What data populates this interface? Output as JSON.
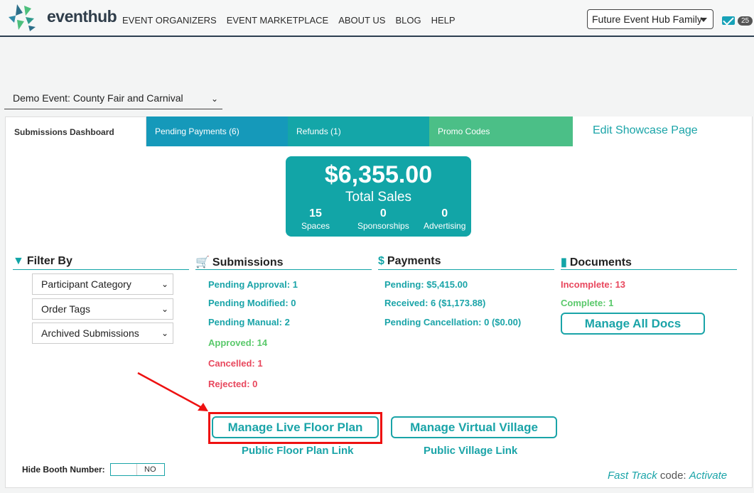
{
  "header": {
    "logo_text": "eventhub",
    "nav": [
      "EVENT ORGANIZERS",
      "EVENT MARKETPLACE",
      "ABOUT US",
      "BLOG",
      "HELP"
    ],
    "family_select": "Future Event Hub Family",
    "mail_badge": "25"
  },
  "event_select": "Demo Event: County Fair and Carnival",
  "tabs": {
    "active": "Submissions Dashboard",
    "pending_payments": "Pending Payments (6)",
    "refunds": "Refunds (1)",
    "promo_codes": "Promo Codes",
    "showcase": "Edit Showcase Page"
  },
  "sales": {
    "amount": "$6,355.00",
    "label": "Total Sales",
    "spaces_n": "15",
    "spaces_l": "Spaces",
    "sponsorships_n": "0",
    "sponsorships_l": "Sponsorships",
    "advertising_n": "0",
    "advertising_l": "Advertising"
  },
  "filter": {
    "heading": "Filter By",
    "options": [
      "Participant Category",
      "Order Tags",
      "Archived Submissions"
    ]
  },
  "submissions": {
    "heading": "Submissions",
    "pending_approval": "Pending Approval: 1",
    "pending_modified": "Pending Modified: 0",
    "pending_manual": "Pending Manual: 2",
    "approved": "Approved: 14",
    "cancelled": "Cancelled: 1",
    "rejected": "Rejected: 0"
  },
  "payments": {
    "heading": "Payments",
    "pending": "Pending: $5,415.00",
    "received": "Received: 6 ($1,173.88)",
    "pending_cancel": "Pending Cancellation: 0 ($0.00)"
  },
  "documents": {
    "heading": "Documents",
    "incomplete": "Incomplete: 13",
    "complete": "Complete: 1",
    "manage": "Manage All Docs"
  },
  "floor": {
    "manage_floor": "Manage Live Floor Plan",
    "public_floor": "Public Floor Plan Link",
    "manage_village": "Manage Virtual Village",
    "public_village": "Public Village Link"
  },
  "booth": {
    "label": "Hide Booth Number:",
    "toggle": "NO"
  },
  "fasttrack": {
    "a": "Fast Track",
    "b": " code: ",
    "c": "Activate"
  },
  "colors": {
    "teal": "#12a5a7",
    "blue_tab": "#1599ba",
    "green_tab": "#4bbf87",
    "highlight": "#e11111"
  }
}
